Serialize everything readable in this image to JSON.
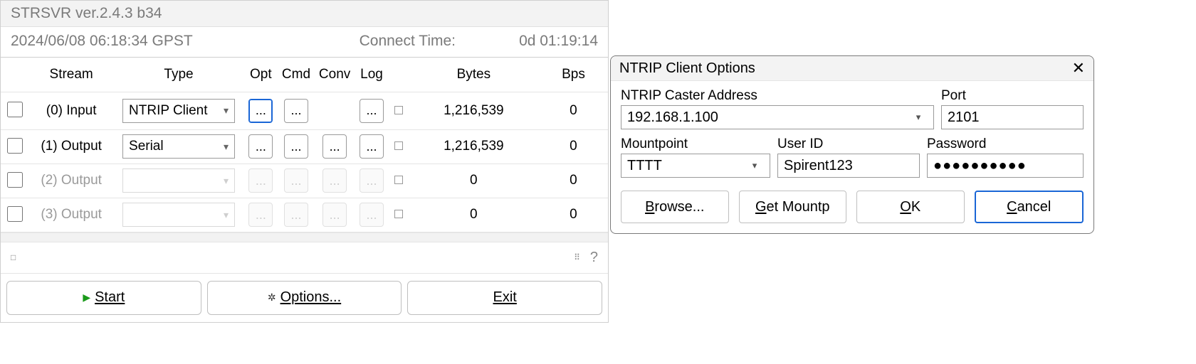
{
  "main": {
    "title": "STRSVR ver.2.4.3 b34",
    "timestamp": "2024/06/08 06:18:34 GPST",
    "connect_label": "Connect Time:",
    "connect_value": "0d 01:19:14",
    "headers": {
      "stream": "Stream",
      "type": "Type",
      "opt": "Opt",
      "cmd": "Cmd",
      "conv": "Conv",
      "log": "Log",
      "bytes": "Bytes",
      "bps": "Bps"
    },
    "rows": [
      {
        "name": "(0) Input",
        "type": "NTRIP Client",
        "enabled": true,
        "opt": true,
        "cmd": true,
        "conv": false,
        "log": true,
        "bytes": "1,216,539",
        "bps": "0"
      },
      {
        "name": "(1) Output",
        "type": "Serial",
        "enabled": true,
        "opt": true,
        "cmd": true,
        "conv": true,
        "log": true,
        "bytes": "1,216,539",
        "bps": "0"
      },
      {
        "name": "(2) Output",
        "type": "",
        "enabled": false,
        "opt": false,
        "cmd": false,
        "conv": false,
        "log": false,
        "bytes": "0",
        "bps": "0"
      },
      {
        "name": "(3) Output",
        "type": "",
        "enabled": false,
        "opt": false,
        "cmd": false,
        "conv": false,
        "log": false,
        "bytes": "0",
        "bps": "0"
      }
    ],
    "info_marker": "□",
    "help_marker": "?",
    "buttons": {
      "start": "Start",
      "options": "Options...",
      "exit": "Exit"
    },
    "dots": "..."
  },
  "dialog": {
    "title": "NTRIP Client Options",
    "labels": {
      "address": "NTRIP Caster Address",
      "port": "Port",
      "mountpoint": "Mountpoint",
      "userid": "User ID",
      "password": "Password"
    },
    "values": {
      "address": "192.168.1.100",
      "port": "2101",
      "mountpoint": "TTTT",
      "userid": "Spirent123",
      "password": "●●●●●●●●●●"
    },
    "buttons": {
      "browse": "Browse...",
      "getmountp": "Get Mountp",
      "ok": "OK",
      "cancel": "Cancel"
    }
  }
}
